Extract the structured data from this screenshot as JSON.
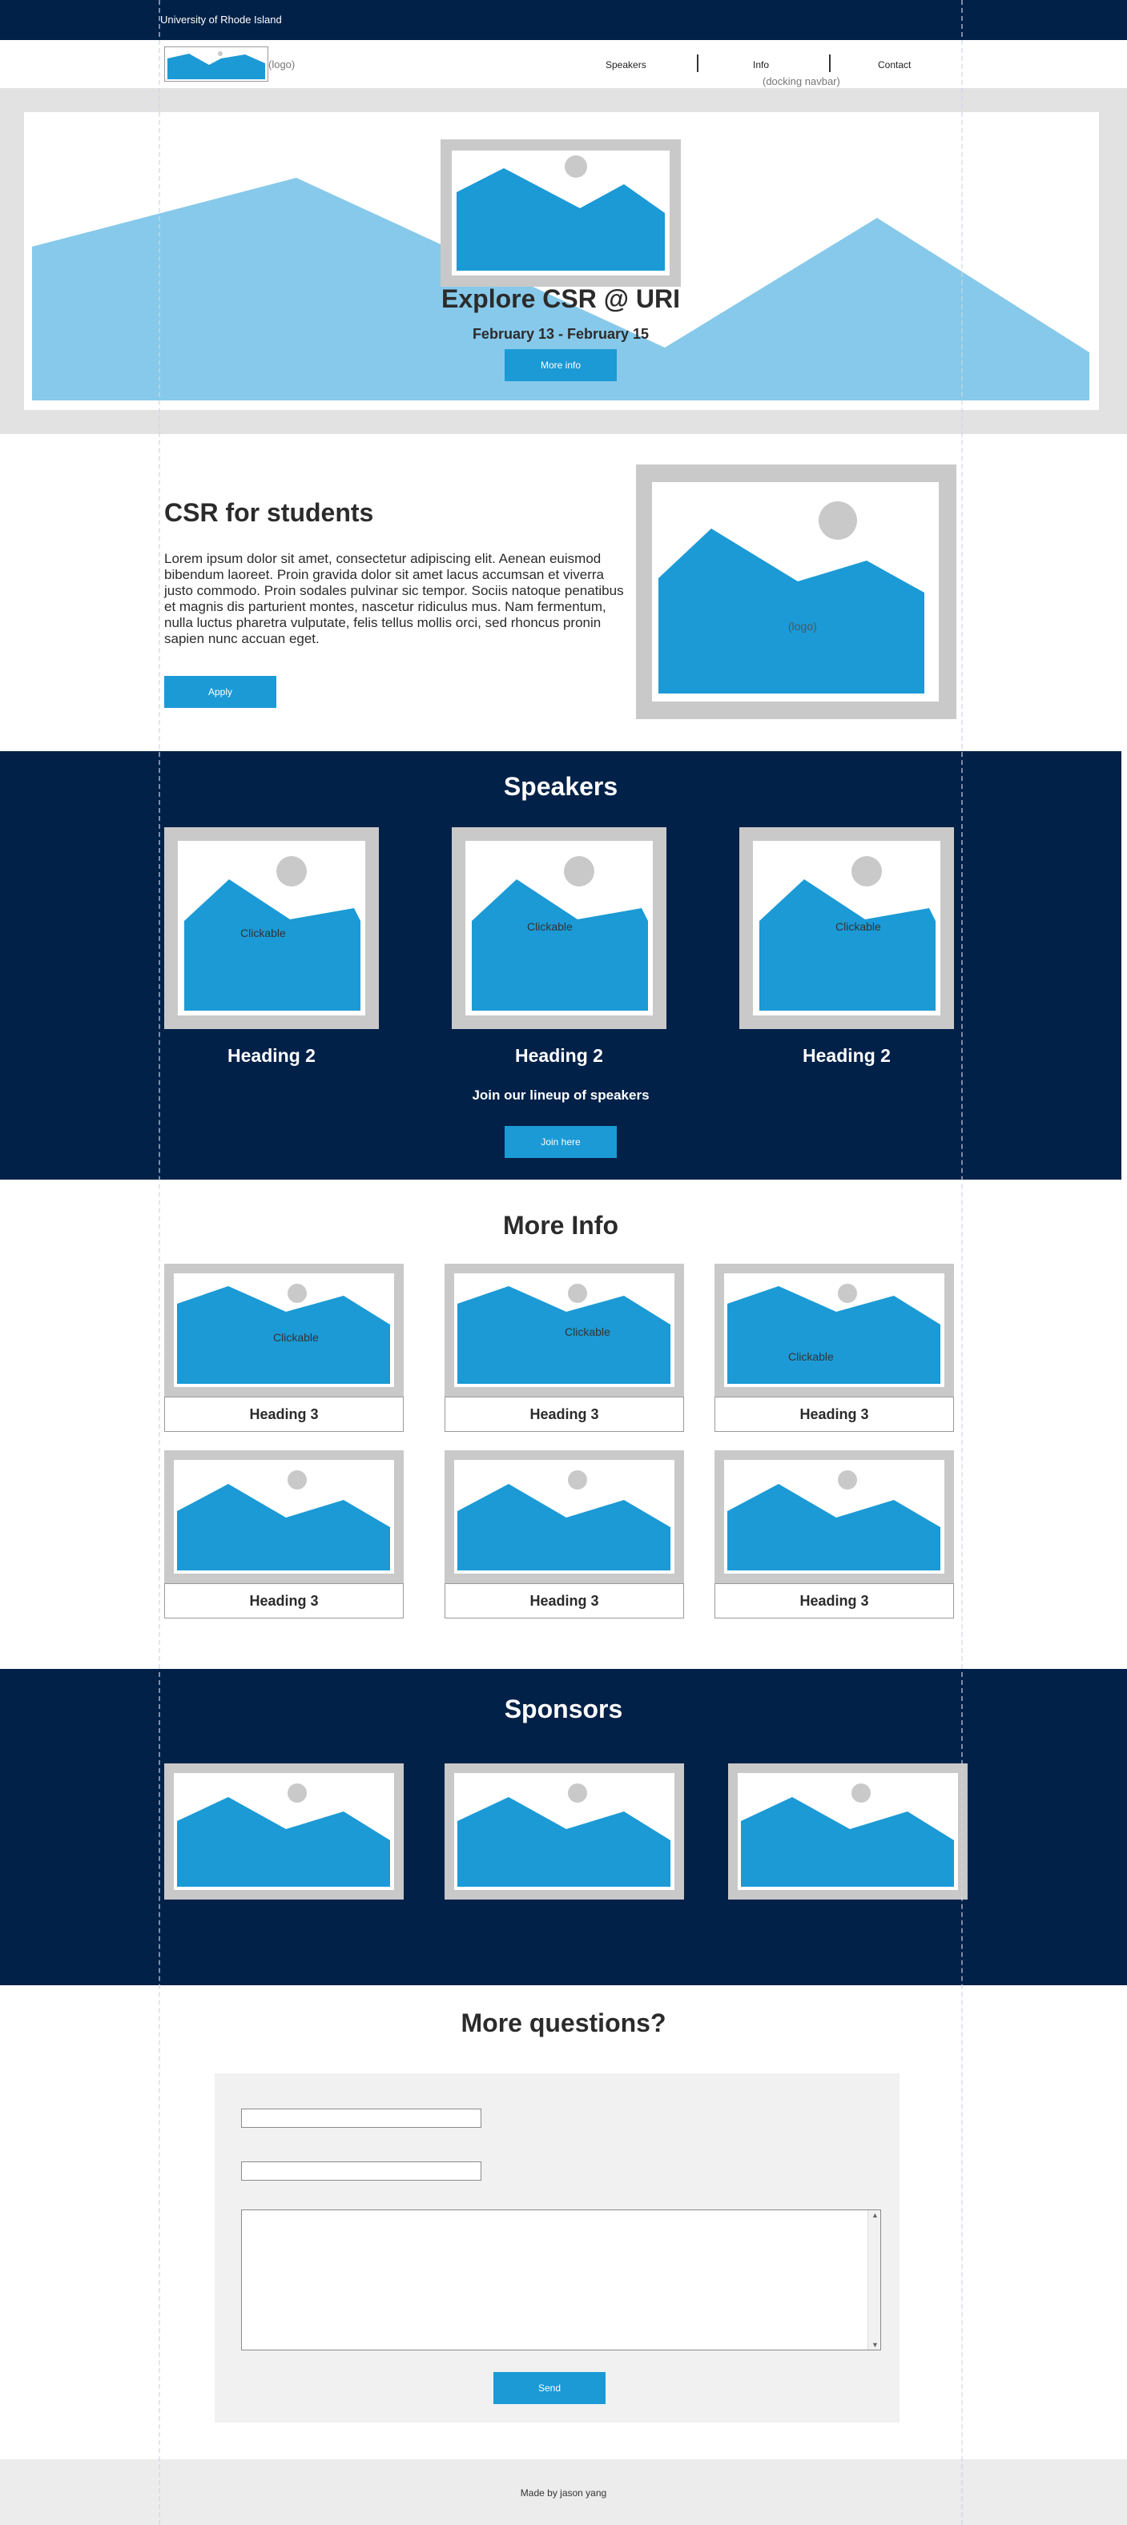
{
  "topbar": {
    "university": "University of Rhode Island"
  },
  "nav": {
    "logo_label": "(logo)",
    "items": [
      {
        "label": "Speakers"
      },
      {
        "label": "Info"
      },
      {
        "label": "Contact"
      }
    ],
    "docking_note": "(docking navbar)"
  },
  "hero": {
    "title": "Explore CSR @ URI",
    "dates": "February 13 - February 15",
    "button_label": "More info"
  },
  "intro": {
    "heading": "CSR for students",
    "body": "Lorem ipsum dolor sit amet, consectetur adipiscing elit. Aenean euismod bibendum laoreet. Proin gravida dolor sit amet lacus accumsan et viverra justo commodo. Proin sodales pulvinar sic tempor. Sociis natoque penatibus et magnis dis parturient montes, nascetur ridiculus mus. Nam fermentum, nulla luctus pharetra vulputate, felis tellus mollis orci, sed rhoncus pronin sapien nunc accuan eget.",
    "button_label": "Apply",
    "image_caption": "(logo)"
  },
  "speakers": {
    "heading": "Speakers",
    "cards": [
      {
        "caption": "Clickable",
        "title": "Heading 2"
      },
      {
        "caption": "Clickable",
        "title": "Heading 2"
      },
      {
        "caption": "Clickable",
        "title": "Heading 2"
      }
    ],
    "subheading": "Join our lineup of speakers",
    "button_label": "Join here"
  },
  "more_info": {
    "heading": "More Info",
    "cards": [
      {
        "caption": "Clickable",
        "title": "Heading 3"
      },
      {
        "caption": "Clickable",
        "title": "Heading 3"
      },
      {
        "caption": "Clickable",
        "title": "Heading 3"
      },
      {
        "caption": "",
        "title": "Heading 3"
      },
      {
        "caption": "",
        "title": "Heading 3"
      },
      {
        "caption": "",
        "title": "Heading 3"
      }
    ]
  },
  "sponsors": {
    "heading": "Sponsors"
  },
  "contact": {
    "heading": "More questions?",
    "send_label": "Send"
  },
  "footer": {
    "text": "Made by jason yang"
  },
  "colors": {
    "navy": "#012148",
    "accent_blue": "#1b9ad6",
    "light_blue": "#87c9ea",
    "placeholder_gray": "#c9c9c9"
  }
}
